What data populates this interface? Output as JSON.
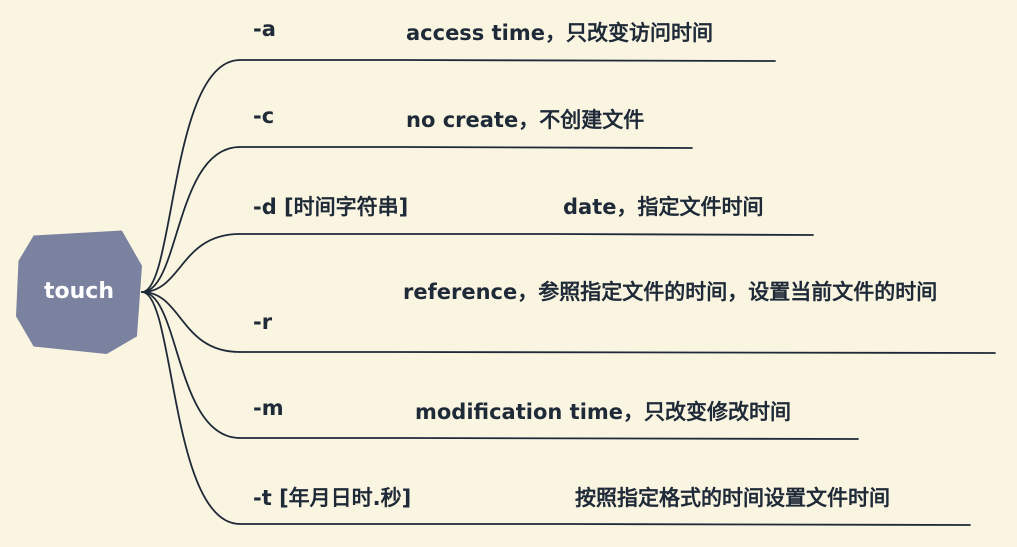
{
  "root": {
    "label": "touch"
  },
  "branches": [
    {
      "option": "-a",
      "description": "access time，只改变访问时间"
    },
    {
      "option": "-c",
      "description": "no create，不创建文件"
    },
    {
      "option": "-d [时间字符串]",
      "description": "date，指定文件时间"
    },
    {
      "option": "-r",
      "description": "reference，参照指定文件的时间，设置当前文件的时间"
    },
    {
      "option": "-m",
      "description": "modification time，只改变修改时间"
    },
    {
      "option": "-t [年月日时.秒]",
      "description": "按照指定格式的时间设置文件时间"
    }
  ],
  "colors": {
    "background": "#faf5e1",
    "root": "#7a829f",
    "line": "#1f2a38"
  }
}
